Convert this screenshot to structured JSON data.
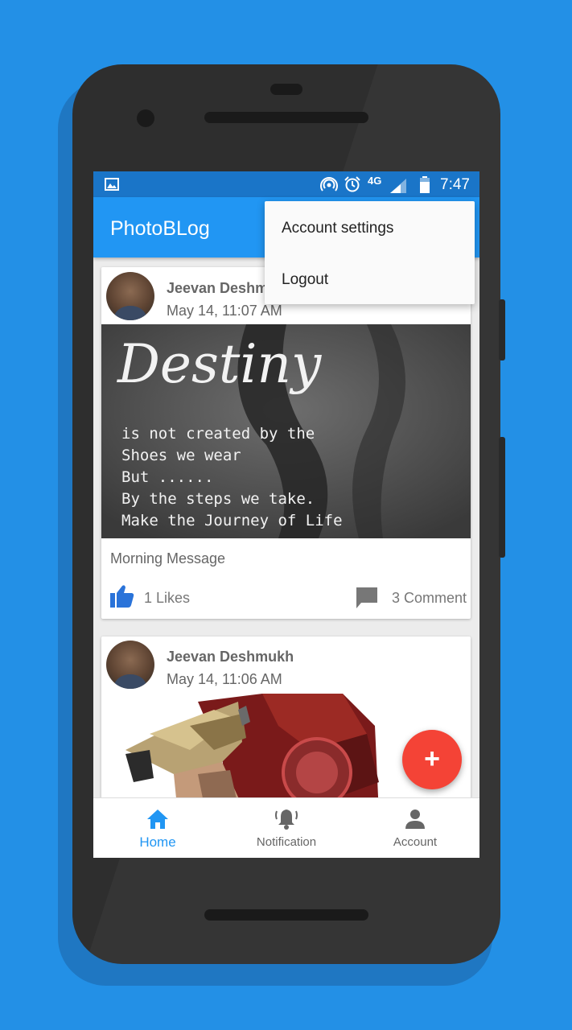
{
  "status_bar": {
    "network": "4G",
    "time": "7:47"
  },
  "app_bar": {
    "title": "PhotoBLog"
  },
  "overflow_menu": {
    "items": [
      "Account settings",
      "Logout"
    ]
  },
  "posts": [
    {
      "author": "Jeevan Deshmukh",
      "date": "May 14, 11:07 AM",
      "image_text": {
        "title": "Destiny",
        "lines": [
          "is not created by the",
          "Shoes we wear",
          "But ......",
          "By the steps we take.",
          "Make the Journey of Life"
        ]
      },
      "caption": "Morning Message",
      "likes": "1 Likes",
      "comments": "3 Comment"
    },
    {
      "author": "Jeevan Deshmukh",
      "date": "May 14, 11:06 AM"
    }
  ],
  "fab": {
    "icon": "plus-icon",
    "label": "+"
  },
  "bottom_nav": {
    "items": [
      {
        "label": "Home",
        "icon": "home-icon",
        "active": true
      },
      {
        "label": "Notification",
        "icon": "bell-icon",
        "active": false
      },
      {
        "label": "Account",
        "icon": "person-icon",
        "active": false
      }
    ]
  },
  "colors": {
    "background": "#2390e6",
    "primary": "#2196f3",
    "status_bar": "#1a75c8",
    "fab": "#f44336"
  }
}
